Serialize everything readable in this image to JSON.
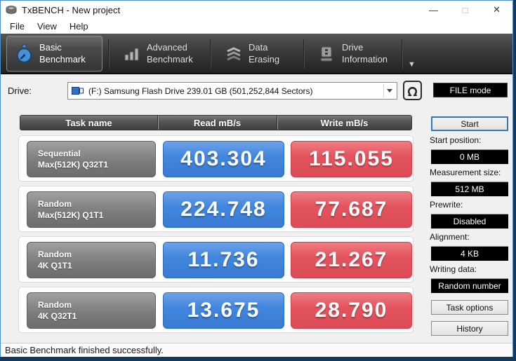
{
  "window": {
    "title": "TxBENCH - New project",
    "controls": {
      "minimize": "—",
      "maximize": "□",
      "close": "✕"
    }
  },
  "menu": {
    "items": [
      "File",
      "View",
      "Help"
    ]
  },
  "toolbar": {
    "tabs": [
      {
        "line1": "Basic",
        "line2": "Benchmark",
        "icon": "stopwatch-icon",
        "active": true
      },
      {
        "line1": "Advanced",
        "line2": "Benchmark",
        "icon": "bar-chart-icon",
        "active": false
      },
      {
        "line1": "Data Erasing",
        "line2": "",
        "icon": "eraser-icon",
        "active": false
      },
      {
        "line1": "Drive",
        "line2": "Information",
        "icon": "drive-icon",
        "active": false
      }
    ],
    "more_icon": "▼"
  },
  "drive": {
    "label": "Drive:",
    "selected": "(F:) Samsung Flash Drive  239.01 GB (501,252,844 Sectors)",
    "mode_button": "FILE mode"
  },
  "table": {
    "headers": [
      "Task name",
      "Read mB/s",
      "Write mB/s"
    ],
    "rows": [
      {
        "task_line1": "Sequential",
        "task_line2": "Max(512K) Q32T1",
        "read": "403.304",
        "write": "115.055"
      },
      {
        "task_line1": "Random",
        "task_line2": "Max(512K) Q1T1",
        "read": "224.748",
        "write": "77.687"
      },
      {
        "task_line1": "Random",
        "task_line2": "4K Q1T1",
        "read": "11.736",
        "write": "21.267"
      },
      {
        "task_line1": "Random",
        "task_line2": "4K Q32T1",
        "read": "13.675",
        "write": "28.790"
      }
    ]
  },
  "sidebar": {
    "start_button": "Start",
    "fields": [
      {
        "label": "Start position:",
        "value": "0 MB"
      },
      {
        "label": "Measurement size:",
        "value": "512 MB"
      },
      {
        "label": "Prewrite:",
        "value": "Disabled"
      },
      {
        "label": "Alignment:",
        "value": "4 KB"
      },
      {
        "label": "Writing data:",
        "value": "Random number"
      }
    ],
    "task_options_button": "Task options",
    "history_button": "History"
  },
  "status": {
    "text": "Basic Benchmark finished successfully."
  },
  "colors": {
    "accent_blue": "#4287de",
    "accent_red": "#e4545e",
    "toolbar_dark": "#3a3a3a",
    "window_border": "#4f8ec6",
    "desktop_navy": "#15395c",
    "value_text": "#ffffff"
  }
}
